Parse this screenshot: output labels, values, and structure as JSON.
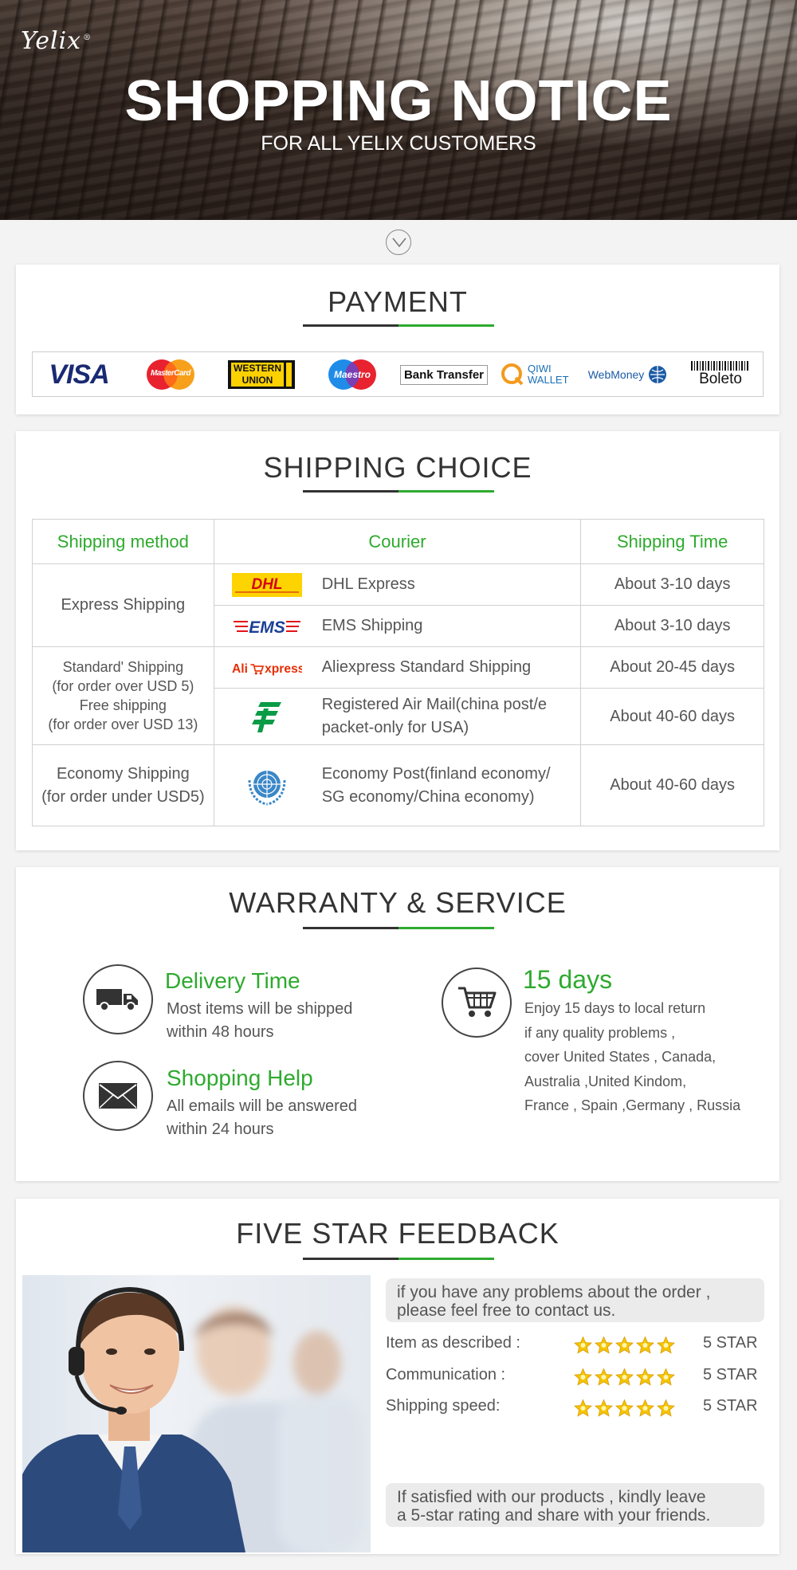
{
  "hero": {
    "logo": "Yelix",
    "logo_mark": "®",
    "title": "SHOPPING NOTICE",
    "subtitle": "FOR ALL YELIX CUSTOMERS"
  },
  "payment": {
    "title": "PAYMENT",
    "methods": [
      {
        "label": "VISA",
        "icon": "visa-logo"
      },
      {
        "label": "MasterCard",
        "icon": "mastercard-logo"
      },
      {
        "label": "WESTERN UNION",
        "icon": "western-union-logo"
      },
      {
        "label": "Maestro",
        "icon": "maestro-logo"
      },
      {
        "label": "Bank Transfer",
        "icon": "bank-transfer-logo"
      },
      {
        "label": "QIWI WALLET",
        "icon": "qiwi-wallet-logo"
      },
      {
        "label": "WebMoney",
        "icon": "webmoney-logo"
      },
      {
        "label": "Boleto",
        "icon": "boleto-logo"
      }
    ]
  },
  "shipping": {
    "title": "SHIPPING CHOICE",
    "headers": [
      "Shipping method",
      "Courier",
      "Shipping Time"
    ],
    "groups": {
      "express": "Express Shipping",
      "standard": "Standard' Shipping\n(for order over USD 5)\nFree shipping\n(for order over USD 13)",
      "economy": "Economy Shipping\n(for order under USD5)"
    },
    "rows": [
      {
        "courier": "DHL Express",
        "icon": "dhl-logo",
        "time": "About 3-10 days"
      },
      {
        "courier": "EMS Shipping",
        "icon": "ems-logo",
        "time": "About 3-10 days"
      },
      {
        "courier": "Aliexpress Standard Shipping",
        "icon": "aliexpress-logo",
        "time": "About 20-45 days"
      },
      {
        "courier": "Registered Air Mail(china post/e packet-only for USA)",
        "icon": "china-post-logo",
        "time": "About 40-60 days"
      },
      {
        "courier": "Economy Post(finland economy/ SG economy/China economy)",
        "icon": "un-logo",
        "time": "About 40-60 days"
      }
    ]
  },
  "warranty": {
    "title": "WARRANTY & SERVICE",
    "delivery": {
      "head": "Delivery Time",
      "text": "Most items will be shipped within 48 hours",
      "icon": "truck-icon"
    },
    "help": {
      "head": "Shopping Help",
      "text": "All emails will be answered within 24 hours",
      "icon": "envelope-icon"
    },
    "returns": {
      "head": "15 days",
      "text": "Enjoy 15 days to local return\nif any quality problems ,\ncover United States , Canada,\nAustralia ,United Kindom,\nFrance , Spain ,Germany , Russia",
      "icon": "cart-icon"
    }
  },
  "feedback": {
    "title": "FIVE STAR FEEDBACK",
    "bubble_top": "if you have any problems about the order ,\nplease feel free to contact us.",
    "ratings": [
      {
        "label": "Item as described :",
        "stars": 5,
        "value": "5 STAR"
      },
      {
        "label": "Communication :",
        "stars": 5,
        "value": "5 STAR"
      },
      {
        "label": "Shipping speed:",
        "stars": 5,
        "value": "5 STAR"
      }
    ],
    "bubble_bottom": "If satisfied with our products , kindly leave\na 5-star rating and share with your friends."
  },
  "colors": {
    "accent": "#2eaa2e",
    "dark": "#333333",
    "star": "#f5c400"
  }
}
